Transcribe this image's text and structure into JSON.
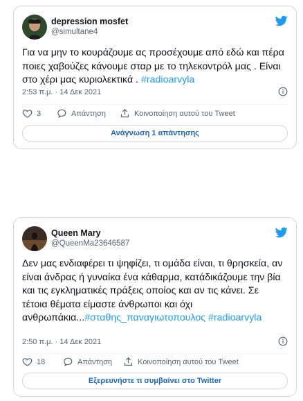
{
  "tweets": [
    {
      "name": "depression mosfet",
      "handle": "@simultane4",
      "text": "Για να μην το κουράζουμε ας προσέχουμε από εδώ και πέρα ποιες χαβούζες κάνουμε σταρ με το τηλεκοντρόλ μας . Είναι στο χέρι μας κυριολεκτικά .",
      "hashtags": "#radioarvyla",
      "time": "2:53 π.μ. · 14 Δεκ 2021",
      "likes": "3",
      "reply_label": "Απάντηση",
      "share_label": "Κοινοποίηση αυτού του Tweet",
      "button_label": "Ανάγνωση 1 απάντησης"
    },
    {
      "name": "Queen Mary",
      "handle": "@QueenMa23646587",
      "text": "Δεν μας ενδιαφέρει τι ψηφίζει, τι ομάδα είναι, τι θρησκεία, αν είναι άνδρας ή γυναίκα ένα κάθαρμα, κατάδικάζουμε την βία και τις εγκληματικές πράξεις οποίος και αν τις κάνει. Σε τέτοια θέματα είμαστε άνθρωποι και όχι\nανθρωπάκια...",
      "hashtags": "#σταθης_παναγιωτοπουλος #radioarvyla",
      "time": "2:50 π.μ. · 14 Δεκ 2021",
      "likes": "18",
      "reply_label": "Απάντηση",
      "share_label": "Κοινοποίηση αυτού του Tweet",
      "button_label": "Εξερευνήστε τι συμβαίνει στο Twitter"
    }
  ],
  "colors": {
    "accent": "#1d9bf0",
    "link_button": "#1d67b8",
    "muted": "#536471",
    "border": "#cfd9de"
  }
}
